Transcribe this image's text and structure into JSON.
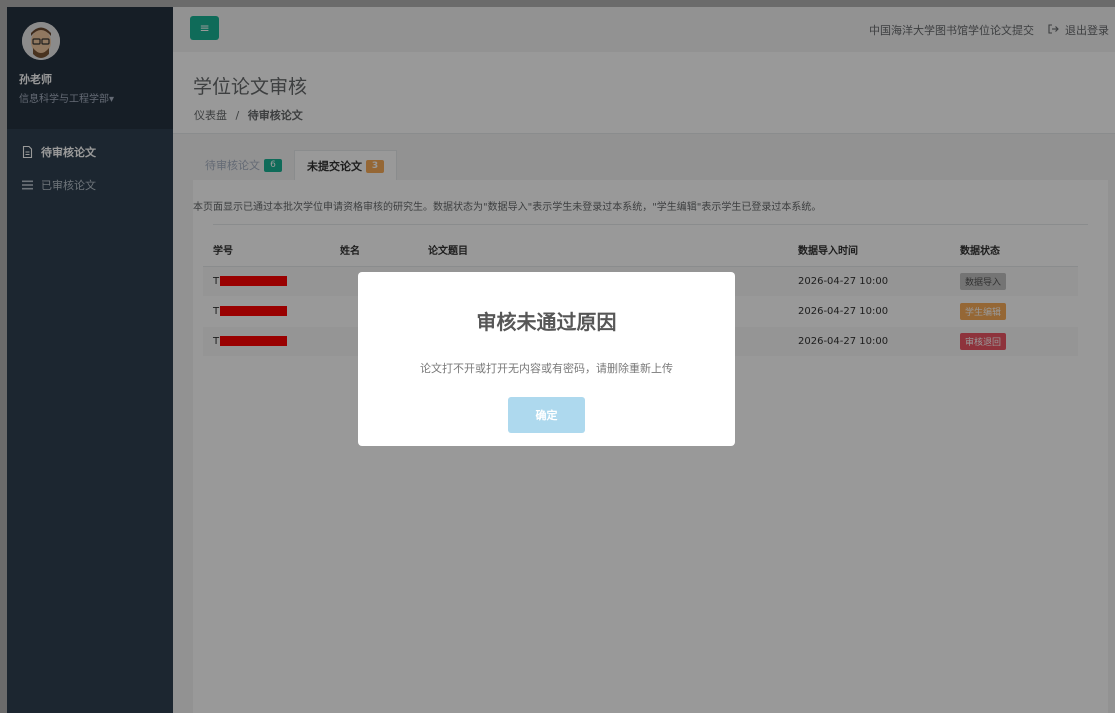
{
  "user": {
    "name": "孙老师",
    "department": "信息科学与工程学部▾"
  },
  "sidebar": {
    "items": [
      {
        "label": "待审核论文",
        "icon": "file-icon"
      },
      {
        "label": "已审核论文",
        "icon": "list-icon"
      }
    ]
  },
  "topbar": {
    "toggle_icon": "≡",
    "system_title": "中国海洋大学图书馆学位论文提交",
    "logout_label": "退出登录",
    "logout_icon": "sign-out-icon"
  },
  "page": {
    "title": "学位论文审核",
    "breadcrumb": [
      "仪表盘",
      "待审核论文"
    ],
    "breadcrumb_sep": "/"
  },
  "tabs": [
    {
      "label": "待审核论文",
      "badge": "6",
      "badge_color": "#1ab394",
      "active": false
    },
    {
      "label": "未提交论文",
      "badge": "3",
      "badge_color": "#f8ac59",
      "active": true
    }
  ],
  "notice": "本页面显示已通过本批次学位申请资格审核的研究生。数据状态为\"数据导入\"表示学生未登录过本系统，\"学生编辑\"表示学生已登录过本系统。",
  "table": {
    "headers": [
      "学号",
      "姓名",
      "论文题目",
      "数据导入时间",
      "数据状态"
    ],
    "rows": [
      {
        "student_id": "T",
        "name": "",
        "title": "",
        "import_time": "2026-04-27 10:00",
        "status": "数据导入",
        "status_color": "#c2c2c2"
      },
      {
        "student_id": "T",
        "name": "",
        "title": "",
        "import_time": "2026-04-27 10:00",
        "status": "学生编辑",
        "status_color": "#f8ac59"
      },
      {
        "student_id": "T",
        "name": "",
        "title": "",
        "import_time": "2026-04-27 10:00",
        "status": "审核退回",
        "status_color": "#ed5565"
      }
    ]
  },
  "modal": {
    "title": "审核未通过原因",
    "message": "论文打不开或打开无内容或有密码，请删除重新上传",
    "confirm_label": "确定"
  },
  "colors": {
    "sidebar": "#2f4050",
    "accent": "#1ab394",
    "confirm_button": "#aed9ee"
  }
}
